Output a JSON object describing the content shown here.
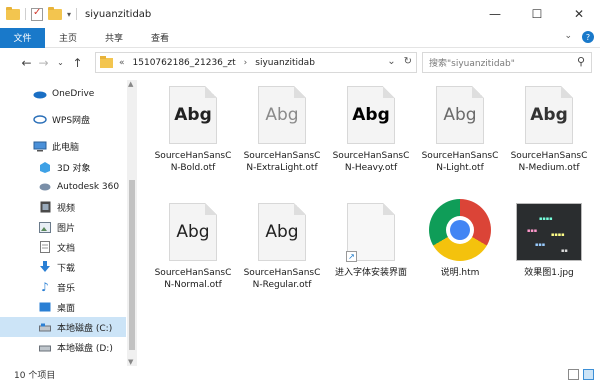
{
  "window": {
    "title": "siyuanzitidab"
  },
  "ribbon": {
    "tabs": [
      "文件",
      "主页",
      "共享",
      "查看"
    ]
  },
  "address": {
    "breadcrumbs": [
      "1510762186_21236_zt",
      "siyuanzitidab"
    ],
    "overflow": "«",
    "search_placeholder": "搜索\"siyuanzitidab\""
  },
  "sidebar": {
    "items": [
      {
        "label": "OneDrive",
        "icon": "cloud-icon"
      },
      {
        "label": "WPS网盘",
        "icon": "wps-cloud-icon"
      },
      {
        "label": "此电脑",
        "icon": "computer-icon"
      },
      {
        "label": "3D 对象",
        "icon": "3d-objects-icon"
      },
      {
        "label": "Autodesk 360",
        "icon": "autodesk-icon"
      },
      {
        "label": "视频",
        "icon": "video-icon"
      },
      {
        "label": "图片",
        "icon": "pictures-icon"
      },
      {
        "label": "文档",
        "icon": "documents-icon"
      },
      {
        "label": "下载",
        "icon": "download-icon"
      },
      {
        "label": "音乐",
        "icon": "music-icon"
      },
      {
        "label": "桌面",
        "icon": "desktop-icon"
      },
      {
        "label": "本地磁盘 (C:)",
        "icon": "drive-icon"
      },
      {
        "label": "本地磁盘 (D:)",
        "icon": "drive-icon"
      }
    ]
  },
  "files": [
    {
      "name": "SourceHanSansCN-Bold.otf",
      "type": "font",
      "preview": "Abg"
    },
    {
      "name": "SourceHanSansCN-ExtraLight.otf",
      "type": "font",
      "preview": "Abg"
    },
    {
      "name": "SourceHanSansCN-Heavy.otf",
      "type": "font",
      "preview": "Abg"
    },
    {
      "name": "SourceHanSansCN-Light.otf",
      "type": "font",
      "preview": "Abg"
    },
    {
      "name": "SourceHanSansCN-Medium.otf",
      "type": "font",
      "preview": "Abg"
    },
    {
      "name": "SourceHanSansCN-Normal.otf",
      "type": "font",
      "preview": "Abg"
    },
    {
      "name": "SourceHanSansCN-Regular.otf",
      "type": "font",
      "preview": "Abg"
    },
    {
      "name": "进入字体安装界面",
      "type": "shortcut"
    },
    {
      "name": "说明.htm",
      "type": "chrome-html"
    },
    {
      "name": "效果图1.jpg",
      "type": "image"
    }
  ],
  "status": {
    "count": "10 个项目"
  }
}
